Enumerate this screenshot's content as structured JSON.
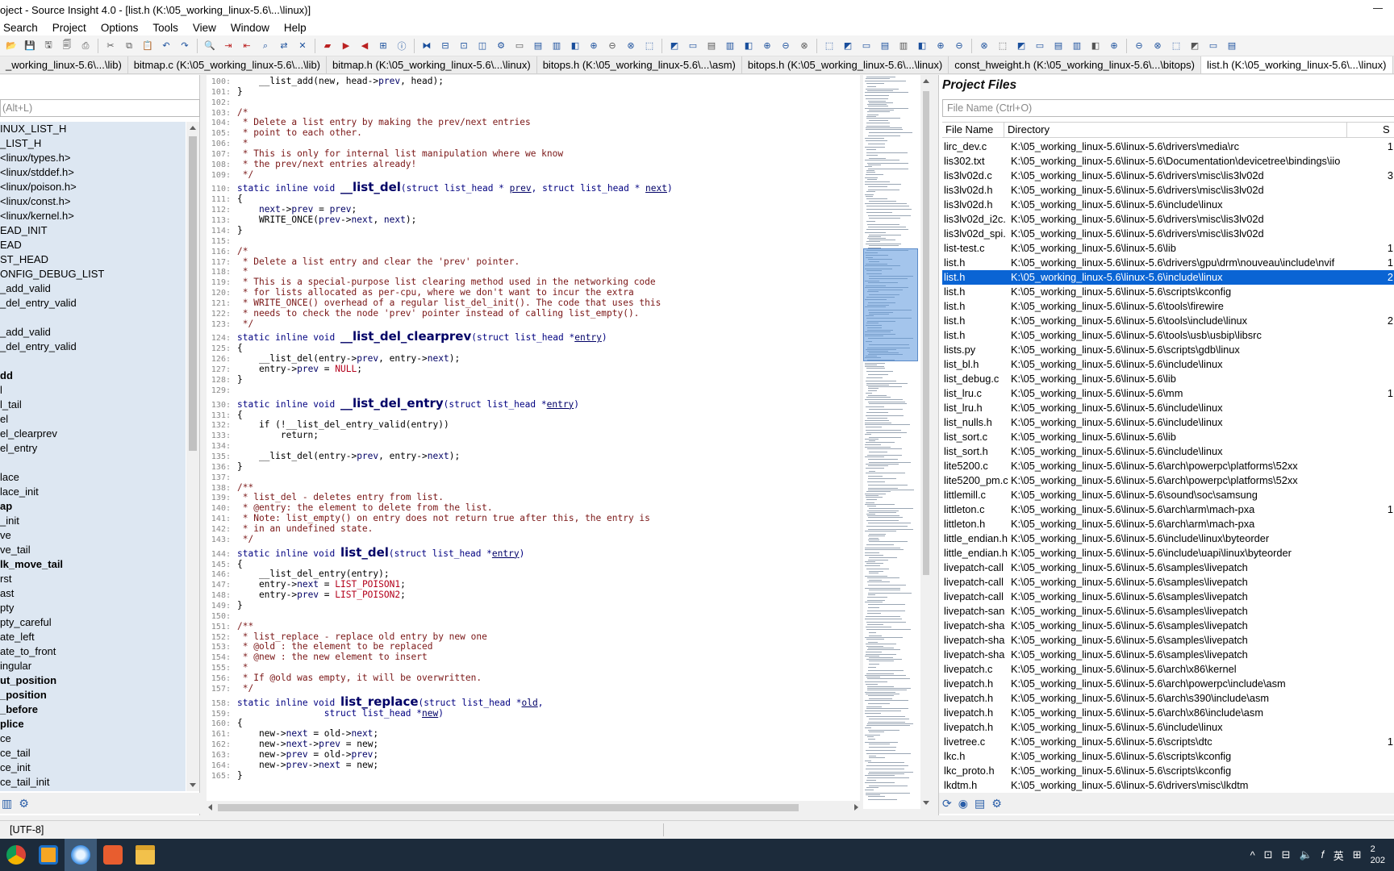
{
  "window": {
    "title": "oject - Source Insight 4.0 - [list.h (K:\\05_working_linux-5.6\\...\\linux)]"
  },
  "menu": [
    "Search",
    "Project",
    "Options",
    "Tools",
    "View",
    "Window",
    "Help"
  ],
  "toolbar_icons": [
    "open-icon",
    "save-icon",
    "save-as-icon",
    "save-all-icon",
    "print-icon",
    "cut-icon",
    "copy-icon",
    "paste-icon",
    "undo-icon",
    "redo-icon",
    "find-icon",
    "jump-icon",
    "jump-back-icon",
    "lookup-icon",
    "replace-icon",
    "xref-icon",
    "bookmark-icon",
    "bookmark-next-icon",
    "bookmark-prev-icon",
    "browse-icon",
    "symbol-info-icon",
    "relation-icon",
    "window-split-icon",
    "window-tile-icon",
    "context-icon",
    "project-icon"
  ],
  "tabs": [
    "_working_linux-5.6\\...\\lib)",
    "bitmap.c (K:\\05_working_linux-5.6\\...\\lib)",
    "bitmap.h (K:\\05_working_linux-5.6\\...\\linux)",
    "bitops.h (K:\\05_working_linux-5.6\\...\\asm)",
    "bitops.h (K:\\05_working_linux-5.6\\...\\linux)",
    "const_hweight.h (K:\\05_working_linux-5.6\\...\\bitops)",
    "list.h (K:\\05_working_linux-5.6\\...\\linux)"
  ],
  "symbol_panel": {
    "search_placeholder": "(Alt+L)",
    "items": [
      {
        "label": "INUX_LIST_H",
        "bold": false
      },
      {
        "label": "_LIST_H",
        "bold": false
      },
      {
        "label": "  <linux/types.h>",
        "bold": false
      },
      {
        "label": "  <linux/stddef.h>",
        "bold": false
      },
      {
        "label": "  <linux/poison.h>",
        "bold": false
      },
      {
        "label": "  <linux/const.h>",
        "bold": false
      },
      {
        "label": "  <linux/kernel.h>",
        "bold": false
      },
      {
        "label": "EAD_INIT",
        "bold": false
      },
      {
        "label": "EAD",
        "bold": false
      },
      {
        "label": "ST_HEAD",
        "bold": false
      },
      {
        "label": "ONFIG_DEBUG_LIST",
        "bold": false
      },
      {
        "label": "_add_valid",
        "bold": false
      },
      {
        "label": "_del_entry_valid",
        "bold": false
      },
      {
        "label": "",
        "bold": false
      },
      {
        "label": "_add_valid",
        "bold": false
      },
      {
        "label": "_del_entry_valid",
        "bold": false
      },
      {
        "label": "",
        "bold": false
      },
      {
        "label": "dd",
        "bold": true
      },
      {
        "label": "l",
        "bold": false
      },
      {
        "label": "l_tail",
        "bold": false
      },
      {
        "label": "el",
        "bold": false
      },
      {
        "label": "el_clearprev",
        "bold": false
      },
      {
        "label": "el_entry",
        "bold": false
      },
      {
        "label": "",
        "bold": false
      },
      {
        "label": "lace",
        "bold": false
      },
      {
        "label": "lace_init",
        "bold": false
      },
      {
        "label": "ap",
        "bold": true
      },
      {
        "label": "_init",
        "bold": false
      },
      {
        "label": "ve",
        "bold": false
      },
      {
        "label": "ve_tail",
        "bold": false
      },
      {
        "label": "lk_move_tail",
        "bold": true
      },
      {
        "label": "rst",
        "bold": false
      },
      {
        "label": "ast",
        "bold": false
      },
      {
        "label": "pty",
        "bold": false
      },
      {
        "label": "pty_careful",
        "bold": false
      },
      {
        "label": "ate_left",
        "bold": false
      },
      {
        "label": "ate_to_front",
        "bold": false
      },
      {
        "label": "ingular",
        "bold": false
      },
      {
        "label": "ut_position",
        "bold": true
      },
      {
        "label": "_position",
        "bold": true
      },
      {
        "label": "_before",
        "bold": true
      },
      {
        "label": "plice",
        "bold": true
      },
      {
        "label": "ce",
        "bold": false
      },
      {
        "label": "ce_tail",
        "bold": false
      },
      {
        "label": "ce_init",
        "bold": false
      },
      {
        "label": "ce_tail_init",
        "bold": false
      }
    ]
  },
  "code": [
    {
      "n": "100:",
      "t": "plain",
      "s": "    __list_add(new, head->prev, head);"
    },
    {
      "n": "101:",
      "t": "plain",
      "s": "}"
    },
    {
      "n": "102:",
      "t": "plain",
      "s": ""
    },
    {
      "n": "103:",
      "t": "cm",
      "s": "/*"
    },
    {
      "n": "104:",
      "t": "cm",
      "s": " * Delete a list entry by making the prev/next entries"
    },
    {
      "n": "105:",
      "t": "cm",
      "s": " * point to each other."
    },
    {
      "n": "106:",
      "t": "cm",
      "s": " *"
    },
    {
      "n": "107:",
      "t": "cm",
      "s": " * This is only for internal list manipulation where we know"
    },
    {
      "n": "108:",
      "t": "cm",
      "s": " * the prev/next entries already!"
    },
    {
      "n": "109:",
      "t": "cm",
      "s": " */"
    },
    {
      "n": "110:",
      "t": "decl",
      "pre": "static inline void ",
      "fn": "__list_del",
      "post": "(struct list_head * ",
      "a1": "prev",
      "mid": ", struct list_head * ",
      "a2": "next",
      "end": ")"
    },
    {
      "n": "111:",
      "t": "plain",
      "s": "{"
    },
    {
      "n": "112:",
      "t": "plain",
      "s": "    next->prev = prev;"
    },
    {
      "n": "113:",
      "t": "plain",
      "s": "    WRITE_ONCE(prev->next, next);"
    },
    {
      "n": "114:",
      "t": "plain",
      "s": "}"
    },
    {
      "n": "115:",
      "t": "plain",
      "s": ""
    },
    {
      "n": "116:",
      "t": "cm",
      "s": "/*"
    },
    {
      "n": "117:",
      "t": "cm",
      "s": " * Delete a list entry and clear the 'prev' pointer."
    },
    {
      "n": "118:",
      "t": "cm",
      "s": " *"
    },
    {
      "n": "119:",
      "t": "cm",
      "s": " * This is a special-purpose list clearing method used in the networking code"
    },
    {
      "n": "120:",
      "t": "cm",
      "s": " * for lists allocated as per-cpu, where we don't want to incur the extra"
    },
    {
      "n": "121:",
      "t": "cm",
      "s": " * WRITE_ONCE() overhead of a regular list_del_init(). The code that uses this"
    },
    {
      "n": "122:",
      "t": "cm",
      "s": " * needs to check the node 'prev' pointer instead of calling list_empty()."
    },
    {
      "n": "123:",
      "t": "cm",
      "s": " */"
    },
    {
      "n": "124:",
      "t": "decl",
      "pre": "static inline void ",
      "fn": "__list_del_clearprev",
      "post": "(struct list_head *",
      "a1": "entry",
      "mid": "",
      "a2": "",
      "end": ")"
    },
    {
      "n": "125:",
      "t": "plain",
      "s": "{"
    },
    {
      "n": "126:",
      "t": "plain",
      "s": "    __list_del(entry->prev, entry->next);"
    },
    {
      "n": "127:",
      "t": "plain",
      "s": "    entry->prev = NULL;"
    },
    {
      "n": "128:",
      "t": "plain",
      "s": "}"
    },
    {
      "n": "129:",
      "t": "plain",
      "s": ""
    },
    {
      "n": "130:",
      "t": "decl",
      "pre": "static inline void ",
      "fn": "__list_del_entry",
      "post": "(struct list_head *",
      "a1": "entry",
      "mid": "",
      "a2": "",
      "end": ")"
    },
    {
      "n": "131:",
      "t": "plain",
      "s": "{"
    },
    {
      "n": "132:",
      "t": "plain",
      "s": "    if (!__list_del_entry_valid(entry))"
    },
    {
      "n": "133:",
      "t": "plain",
      "s": "        return;"
    },
    {
      "n": "134:",
      "t": "plain",
      "s": ""
    },
    {
      "n": "135:",
      "t": "plain",
      "s": "    __list_del(entry->prev, entry->next);"
    },
    {
      "n": "136:",
      "t": "plain",
      "s": "}"
    },
    {
      "n": "137:",
      "t": "plain",
      "s": ""
    },
    {
      "n": "138:",
      "t": "cm",
      "s": "/**"
    },
    {
      "n": "139:",
      "t": "cm",
      "s": " * list_del - deletes entry from list."
    },
    {
      "n": "140:",
      "t": "cm",
      "s": " * @entry: the element to delete from the list."
    },
    {
      "n": "141:",
      "t": "cm",
      "s": " * Note: list_empty() on entry does not return true after this, the entry is"
    },
    {
      "n": "142:",
      "t": "cm",
      "s": " * in an undefined state."
    },
    {
      "n": "143:",
      "t": "cm",
      "s": " */"
    },
    {
      "n": "144:",
      "t": "decl",
      "pre": "static inline void ",
      "fn": "list_del",
      "post": "(struct list_head *",
      "a1": "entry",
      "mid": "",
      "a2": "",
      "end": ")"
    },
    {
      "n": "145:",
      "t": "plain",
      "s": "{"
    },
    {
      "n": "146:",
      "t": "plain",
      "s": "    __list_del_entry(entry);"
    },
    {
      "n": "147:",
      "t": "plain",
      "s": "    entry->next = LIST_POISON1;"
    },
    {
      "n": "148:",
      "t": "plain",
      "s": "    entry->prev = LIST_POISON2;"
    },
    {
      "n": "149:",
      "t": "plain",
      "s": "}"
    },
    {
      "n": "150:",
      "t": "plain",
      "s": ""
    },
    {
      "n": "151:",
      "t": "cm",
      "s": "/**"
    },
    {
      "n": "152:",
      "t": "cm",
      "s": " * list_replace - replace old entry by new one"
    },
    {
      "n": "153:",
      "t": "cm",
      "s": " * @old : the element to be replaced"
    },
    {
      "n": "154:",
      "t": "cm",
      "s": " * @new : the new element to insert"
    },
    {
      "n": "155:",
      "t": "cm",
      "s": " *"
    },
    {
      "n": "156:",
      "t": "cm",
      "s": " * If @old was empty, it will be overwritten."
    },
    {
      "n": "157:",
      "t": "cm",
      "s": " */"
    },
    {
      "n": "158:",
      "t": "decl",
      "pre": "static inline void ",
      "fn": "list_replace",
      "post": "(struct list_head *",
      "a1": "old",
      "mid": ",",
      "a2": "",
      "end": ""
    },
    {
      "n": "159:",
      "t": "decl2",
      "pre": "                struct list_head *",
      "a1": "new",
      "end": ")"
    },
    {
      "n": "160:",
      "t": "plain",
      "s": "{"
    },
    {
      "n": "161:",
      "t": "plain",
      "s": "    new->next = old->next;"
    },
    {
      "n": "162:",
      "t": "plain",
      "s": "    new->next->prev = new;"
    },
    {
      "n": "163:",
      "t": "plain",
      "s": "    new->prev = old->prev;"
    },
    {
      "n": "164:",
      "t": "plain",
      "s": "    new->prev->next = new;"
    },
    {
      "n": "165:",
      "t": "plain",
      "s": "}"
    }
  ],
  "project_files": {
    "title": "Project Files",
    "search_placeholder": "File Name (Ctrl+O)",
    "columns": [
      "File Name",
      "Directory",
      "S"
    ],
    "rows": [
      {
        "name": "lirc_dev.c",
        "dir": "K:\\05_working_linux-5.6\\linux-5.6\\drivers\\media\\rc",
        "size": "1"
      },
      {
        "name": "lis302.txt",
        "dir": "K:\\05_working_linux-5.6\\linux-5.6\\Documentation\\devicetree\\bindings\\iio",
        "size": ""
      },
      {
        "name": "lis3lv02d.c",
        "dir": "K:\\05_working_linux-5.6\\linux-5.6\\drivers\\misc\\lis3lv02d",
        "size": "3"
      },
      {
        "name": "lis3lv02d.h",
        "dir": "K:\\05_working_linux-5.6\\linux-5.6\\drivers\\misc\\lis3lv02d",
        "size": ""
      },
      {
        "name": "lis3lv02d.h",
        "dir": "K:\\05_working_linux-5.6\\linux-5.6\\include\\linux",
        "size": ""
      },
      {
        "name": "lis3lv02d_i2c.",
        "dir": "K:\\05_working_linux-5.6\\linux-5.6\\drivers\\misc\\lis3lv02d",
        "size": ""
      },
      {
        "name": "lis3lv02d_spi.",
        "dir": "K:\\05_working_linux-5.6\\linux-5.6\\drivers\\misc\\lis3lv02d",
        "size": ""
      },
      {
        "name": "list-test.c",
        "dir": "K:\\05_working_linux-5.6\\linux-5.6\\lib",
        "size": "1"
      },
      {
        "name": "list.h",
        "dir": "K:\\05_working_linux-5.6\\linux-5.6\\drivers\\gpu\\drm\\nouveau\\include\\nvif",
        "size": "1"
      },
      {
        "name": "list.h",
        "dir": "K:\\05_working_linux-5.6\\linux-5.6\\include\\linux",
        "size": "2",
        "selected": true
      },
      {
        "name": "list.h",
        "dir": "K:\\05_working_linux-5.6\\linux-5.6\\scripts\\kconfig",
        "size": ""
      },
      {
        "name": "list.h",
        "dir": "K:\\05_working_linux-5.6\\linux-5.6\\tools\\firewire",
        "size": ""
      },
      {
        "name": "list.h",
        "dir": "K:\\05_working_linux-5.6\\linux-5.6\\tools\\include\\linux",
        "size": "2"
      },
      {
        "name": "list.h",
        "dir": "K:\\05_working_linux-5.6\\linux-5.6\\tools\\usb\\usbip\\libsrc",
        "size": ""
      },
      {
        "name": "lists.py",
        "dir": "K:\\05_working_linux-5.6\\linux-5.6\\scripts\\gdb\\linux",
        "size": ""
      },
      {
        "name": "list_bl.h",
        "dir": "K:\\05_working_linux-5.6\\linux-5.6\\include\\linux",
        "size": ""
      },
      {
        "name": "list_debug.c",
        "dir": "K:\\05_working_linux-5.6\\linux-5.6\\lib",
        "size": ""
      },
      {
        "name": "list_lru.c",
        "dir": "K:\\05_working_linux-5.6\\linux-5.6\\mm",
        "size": "1"
      },
      {
        "name": "list_lru.h",
        "dir": "K:\\05_working_linux-5.6\\linux-5.6\\include\\linux",
        "size": ""
      },
      {
        "name": "list_nulls.h",
        "dir": "K:\\05_working_linux-5.6\\linux-5.6\\include\\linux",
        "size": ""
      },
      {
        "name": "list_sort.c",
        "dir": "K:\\05_working_linux-5.6\\linux-5.6\\lib",
        "size": ""
      },
      {
        "name": "list_sort.h",
        "dir": "K:\\05_working_linux-5.6\\linux-5.6\\include\\linux",
        "size": ""
      },
      {
        "name": "lite5200.c",
        "dir": "K:\\05_working_linux-5.6\\linux-5.6\\arch\\powerpc\\platforms\\52xx",
        "size": ""
      },
      {
        "name": "lite5200_pm.c",
        "dir": "K:\\05_working_linux-5.6\\linux-5.6\\arch\\powerpc\\platforms\\52xx",
        "size": ""
      },
      {
        "name": "littlemill.c",
        "dir": "K:\\05_working_linux-5.6\\linux-5.6\\sound\\soc\\samsung",
        "size": ""
      },
      {
        "name": "littleton.c",
        "dir": "K:\\05_working_linux-5.6\\linux-5.6\\arch\\arm\\mach-pxa",
        "size": "1"
      },
      {
        "name": "littleton.h",
        "dir": "K:\\05_working_linux-5.6\\linux-5.6\\arch\\arm\\mach-pxa",
        "size": ""
      },
      {
        "name": "little_endian.h",
        "dir": "K:\\05_working_linux-5.6\\linux-5.6\\include\\linux\\byteorder",
        "size": ""
      },
      {
        "name": "little_endian.h",
        "dir": "K:\\05_working_linux-5.6\\linux-5.6\\include\\uapi\\linux\\byteorder",
        "size": ""
      },
      {
        "name": "livepatch-call",
        "dir": "K:\\05_working_linux-5.6\\linux-5.6\\samples\\livepatch",
        "size": ""
      },
      {
        "name": "livepatch-call",
        "dir": "K:\\05_working_linux-5.6\\linux-5.6\\samples\\livepatch",
        "size": ""
      },
      {
        "name": "livepatch-call",
        "dir": "K:\\05_working_linux-5.6\\linux-5.6\\samples\\livepatch",
        "size": ""
      },
      {
        "name": "livepatch-san",
        "dir": "K:\\05_working_linux-5.6\\linux-5.6\\samples\\livepatch",
        "size": ""
      },
      {
        "name": "livepatch-sha",
        "dir": "K:\\05_working_linux-5.6\\linux-5.6\\samples\\livepatch",
        "size": ""
      },
      {
        "name": "livepatch-sha",
        "dir": "K:\\05_working_linux-5.6\\linux-5.6\\samples\\livepatch",
        "size": ""
      },
      {
        "name": "livepatch-sha",
        "dir": "K:\\05_working_linux-5.6\\linux-5.6\\samples\\livepatch",
        "size": ""
      },
      {
        "name": "livepatch.c",
        "dir": "K:\\05_working_linux-5.6\\linux-5.6\\arch\\x86\\kernel",
        "size": ""
      },
      {
        "name": "livepatch.h",
        "dir": "K:\\05_working_linux-5.6\\linux-5.6\\arch\\powerpc\\include\\asm",
        "size": ""
      },
      {
        "name": "livepatch.h",
        "dir": "K:\\05_working_linux-5.6\\linux-5.6\\arch\\s390\\include\\asm",
        "size": ""
      },
      {
        "name": "livepatch.h",
        "dir": "K:\\05_working_linux-5.6\\linux-5.6\\arch\\x86\\include\\asm",
        "size": ""
      },
      {
        "name": "livepatch.h",
        "dir": "K:\\05_working_linux-5.6\\linux-5.6\\include\\linux",
        "size": ""
      },
      {
        "name": "livetree.c",
        "dir": "K:\\05_working_linux-5.6\\linux-5.6\\scripts\\dtc",
        "size": "1"
      },
      {
        "name": "lkc.h",
        "dir": "K:\\05_working_linux-5.6\\linux-5.6\\scripts\\kconfig",
        "size": ""
      },
      {
        "name": "lkc_proto.h",
        "dir": "K:\\05_working_linux-5.6\\linux-5.6\\scripts\\kconfig",
        "size": ""
      },
      {
        "name": "lkdtm.h",
        "dir": "K:\\05_working_linux-5.6\\linux-5.6\\drivers\\misc\\lkdtm",
        "size": ""
      }
    ]
  },
  "status": {
    "encoding": "[UTF-8]"
  },
  "taskbar": {
    "apps": [
      "chrome-icon",
      "source-insight-icon",
      "browser-icon",
      "xmind-icon",
      "file-explorer-icon"
    ],
    "tray": [
      "^",
      "⊡",
      "⊟",
      "🔈",
      "𝑓",
      "英",
      "⊞"
    ],
    "clock_line1": "2",
    "clock_line2": "202"
  },
  "colors": {
    "selection": "#0a64d4",
    "comment": "#7a1616",
    "keyword": "#000080",
    "constant": "#b3001b"
  }
}
